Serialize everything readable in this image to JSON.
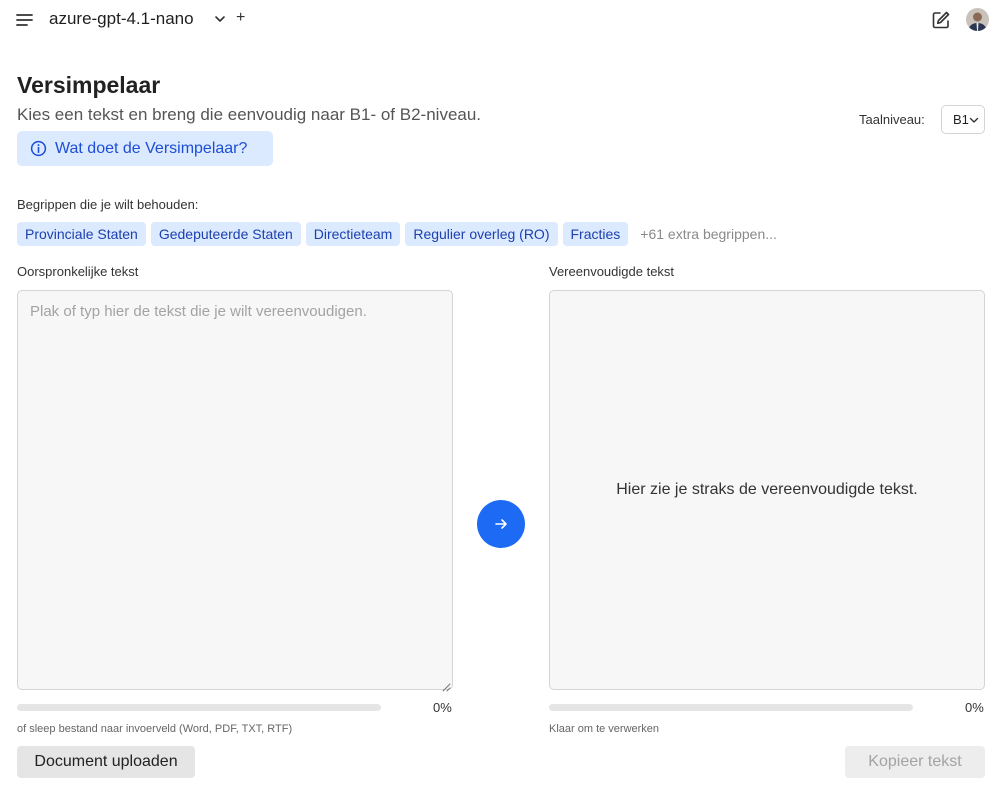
{
  "header": {
    "model_name": "azure-gpt-4.1-nano",
    "new_symbol": "+",
    "icons": [
      "menu-icon",
      "chevron-down-icon",
      "plus-icon",
      "edit-icon",
      "avatar"
    ]
  },
  "page": {
    "title": "Versimpelaar",
    "subtitle": "Kies een tekst en breng die eenvoudig naar B1- of B2-niveau.",
    "info_button": "Wat doet de Versimpelaar?"
  },
  "level": {
    "label": "Taalniveau:",
    "value": "B1"
  },
  "terms": {
    "label": "Begrippen die je wilt behouden:",
    "chips": [
      "Provinciale Staten",
      "Gedeputeerde Staten",
      "Directieteam",
      "Regulier overleg (RO)",
      "Fracties"
    ],
    "extra": "+61 extra begrippen..."
  },
  "input": {
    "label": "Oorspronkelijke tekst",
    "placeholder": "Plak of typ hier de tekst die je wilt vereenvoudigen.",
    "value": "",
    "progress": 0,
    "progress_text": "0%",
    "hint": "of sleep bestand naar invoerveld (Word, PDF, TXT, RTF)",
    "upload_button": "Document uploaden"
  },
  "output": {
    "label": "Vereenvoudigde tekst",
    "placeholder": "Hier zie je straks de vereenvoudigde tekst.",
    "progress": 0,
    "progress_text": "0%",
    "status": "Klaar om te verwerken",
    "copy_button": "Kopieer tekst"
  },
  "colors": {
    "accent": "#1d6af5",
    "chip_bg": "#dbeafe",
    "chip_text": "#1e40af",
    "info_text": "#1d4ed8"
  }
}
